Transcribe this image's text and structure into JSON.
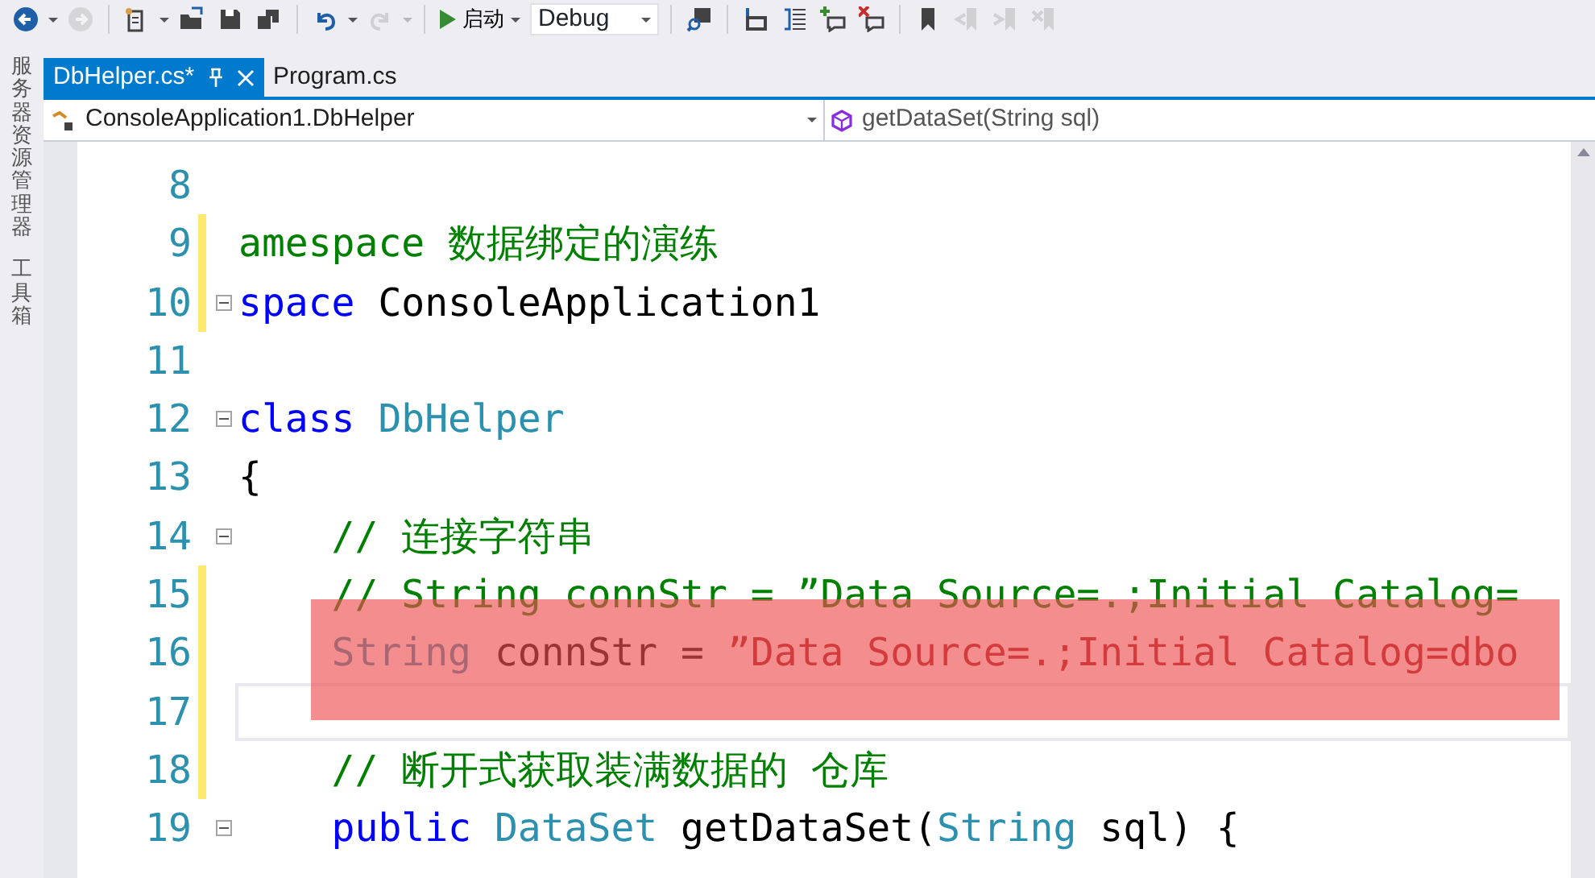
{
  "toolbar": {
    "buttons": [
      {
        "disabled": false
      },
      {
        "disabled": true
      },
      {
        "disabled": false
      },
      {
        "disabled": false
      },
      {
        "disabled": false
      },
      {
        "disabled": false
      },
      {
        "disabled": false
      },
      {
        "disabled": true
      }
    ],
    "start_label": "启动",
    "configuration": "Debug",
    "right_buttons": [
      {
        "disabled": false
      },
      {
        "disabled": false
      },
      {
        "disabled": false
      },
      {
        "disabled": false
      },
      {
        "disabled": false
      },
      {
        "disabled": false
      },
      {
        "disabled": true
      },
      {
        "disabled": true
      },
      {
        "disabled": true
      }
    ]
  },
  "side_tabs": [
    {
      "label": "服务器资源管理器"
    },
    {
      "label": "工具箱"
    }
  ],
  "tabs": [
    {
      "label": "DbHelper.cs*",
      "selected": true
    },
    {
      "label": "Program.cs",
      "selected": false
    }
  ],
  "navigation": {
    "type": "ConsoleApplication1.DbHelper",
    "member": "getDataSet(String sql)"
  },
  "code_lines": [
    {
      "number": "8",
      "changed": false,
      "fold": false,
      "current": false
    },
    {
      "number": "9",
      "changed": true,
      "fold": false,
      "current": false,
      "tokens": [
        {
          "kind": "comment",
          "text": "amespace 数据绑定的演练"
        }
      ]
    },
    {
      "number": "10",
      "changed": true,
      "fold": true,
      "current": false,
      "tokens": [
        {
          "kind": "keyword",
          "text": "space"
        },
        {
          "kind": "plain",
          "text": " ConsoleApplication1"
        }
      ]
    },
    {
      "number": "11",
      "changed": false,
      "fold": false,
      "current": false
    },
    {
      "number": "12",
      "changed": false,
      "fold": true,
      "current": false,
      "tokens": [
        {
          "kind": "keyword",
          "text": "class"
        },
        {
          "kind": "type",
          "text": " DbHelper"
        }
      ]
    },
    {
      "number": "13",
      "changed": false,
      "fold": false,
      "current": false,
      "tokens": [
        {
          "kind": "plain",
          "text": "{"
        }
      ]
    },
    {
      "number": "14",
      "changed": false,
      "fold": true,
      "current": false,
      "indented": true,
      "tokens": [
        {
          "kind": "comment",
          "text": "// 连接字符串"
        }
      ]
    },
    {
      "number": "15",
      "changed": true,
      "fold": false,
      "current": false,
      "indented": true,
      "tokens": [
        {
          "kind": "comment",
          "text": "// String connStr = ”Data Source=.;Initial Catalog="
        }
      ]
    },
    {
      "number": "16",
      "changed": true,
      "fold": false,
      "current": false,
      "indented": true,
      "tokens": [
        {
          "kind": "type",
          "text": "String"
        },
        {
          "kind": "plain",
          "text": " connStr = "
        },
        {
          "kind": "string",
          "text": "”Data Source=.;Initial Catalog=dbo"
        }
      ]
    },
    {
      "number": "17",
      "changed": true,
      "fold": false,
      "current": true
    },
    {
      "number": "18",
      "changed": true,
      "fold": false,
      "current": false,
      "indented": true,
      "tokens": [
        {
          "kind": "comment",
          "text": "// 断开式获取装满数据的 仓库"
        }
      ]
    },
    {
      "number": "19",
      "changed": false,
      "fold": true,
      "current": false,
      "indented": true,
      "tokens": [
        {
          "kind": "keyword",
          "text": "public"
        },
        {
          "kind": "type",
          "text": " DataSet"
        },
        {
          "kind": "plain",
          "text": " getDataSet("
        },
        {
          "kind": "type",
          "text": "String"
        },
        {
          "kind": "plain",
          "text": " sql) {"
        }
      ]
    }
  ]
}
